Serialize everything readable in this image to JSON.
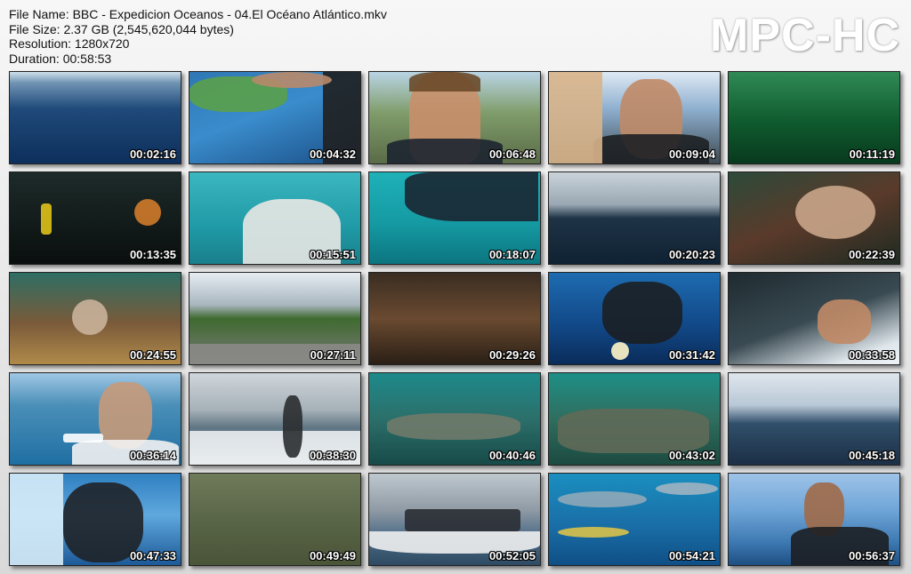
{
  "info": {
    "file_name": "File Name: BBC - Expedicion Oceanos - 04.El Océano Atlántico.mkv",
    "file_size": "File Size: 2.37 GB (2,545,620,044 bytes)",
    "resolution": "Resolution: 1280x720",
    "duration": "Duration: 00:58:53"
  },
  "logo": "MPC-HC",
  "thumbnails": [
    {
      "time": "00:02:16",
      "bg": "linear-gradient(180deg,#cfe0ea 0%,#6f93b3 12%,#1f4a7a 40%,#0d2f5c 100%)",
      "desc": "open-ocean"
    },
    {
      "time": "00:04:32",
      "bg": "linear-gradient(160deg,#2f77b5 0%,#3a8ccc 45%,#1a4f86 100%)",
      "desc": "map-hand"
    },
    {
      "time": "00:06:48",
      "bg": "linear-gradient(180deg,#b9d4e4 0%,#7f9c6a 45%,#5a6b48 100%)",
      "desc": "presenter-face"
    },
    {
      "time": "00:09:04",
      "bg": "linear-gradient(180deg,#dfe9f3 0%,#8fb0d0 40%,#3d4a52 100%)",
      "desc": "man-headphones"
    },
    {
      "time": "00:11:19",
      "bg": "linear-gradient(180deg,#2f8a55 0%,#0f5a2e 55%,#083a1e 100%)",
      "desc": "green-water"
    },
    {
      "time": "00:13:35",
      "bg": "linear-gradient(180deg,#1d2b2a 0%,#111a18 60%,#0a0f0e 100%)",
      "desc": "divers-dark"
    },
    {
      "time": "00:15:51",
      "bg": "linear-gradient(180deg,#3bb7c0 0%,#1f9aa6 60%,#1a7f8c 100%)",
      "desc": "boat-bow"
    },
    {
      "time": "00:18:07",
      "bg": "linear-gradient(180deg,#1fb1b8 0%,#159aa3 55%,#0c7580 100%)",
      "desc": "diver-rope"
    },
    {
      "time": "00:20:23",
      "bg": "linear-gradient(180deg,#c9d3da 0%,#9aa8b3 35%,#1e3346 50%,#0f2233 100%)",
      "desc": "boat-wake"
    },
    {
      "time": "00:22:39",
      "bg": "linear-gradient(160deg,#2d4a3a 0%,#5a3a2a 50%,#1e2a22 100%)",
      "desc": "lionfish"
    },
    {
      "time": "00:24:55",
      "bg": "linear-gradient(180deg,#2e6e63 0%,#7a5a3a 55%,#b08a4a 100%)",
      "desc": "reef-lionfish"
    },
    {
      "time": "00:27:11",
      "bg": "linear-gradient(180deg,#e6edf2 0%,#a8b6bf 35%,#3f6a2f 50%,#7a7a78 100%)",
      "desc": "road"
    },
    {
      "time": "00:29:26",
      "bg": "linear-gradient(180deg,#3a2d22 0%,#6a4a30 50%,#2a1f16 100%)",
      "desc": "cave"
    },
    {
      "time": "00:31:42",
      "bg": "linear-gradient(180deg,#1e6bb0 0%,#124a8a 55%,#0a2c5a 100%)",
      "desc": "diver-descending"
    },
    {
      "time": "00:33:58",
      "bg": "linear-gradient(160deg,#1e2b30 0%,#3a4a52 50%,#dfe7ec 85%,#eef3f6 100%)",
      "desc": "gear-hands"
    },
    {
      "time": "00:36:14",
      "bg": "linear-gradient(180deg,#9fc7e4 0%,#4a8fb8 35%,#1f6fa3 100%)",
      "desc": "woman-boat"
    },
    {
      "time": "00:38:30",
      "bg": "linear-gradient(180deg,#cfd6db 0%,#a7b1b8 40%,#5d7482 60%,#e8ecee 100%)",
      "desc": "man-deck"
    },
    {
      "time": "00:40:46",
      "bg": "linear-gradient(180deg,#1d8a8a 0%,#2c6f6a 50%,#174a48 100%)",
      "desc": "wreck-cannons"
    },
    {
      "time": "00:43:02",
      "bg": "linear-gradient(180deg,#1e8f86 0%,#2f6e5f 50%,#1c4a40 100%)",
      "desc": "wreck-debris"
    },
    {
      "time": "00:45:18",
      "bg": "linear-gradient(180deg,#dfe6ec 0%,#b8c8d6 35%,#314f6b 55%,#1b2f45 100%)",
      "desc": "sea-horizon"
    },
    {
      "time": "00:47:33",
      "bg": "linear-gradient(180deg,#2f7fc0 0%,#5fa8de 45%,#1d5a98 100%)",
      "desc": "diver-splash"
    },
    {
      "time": "00:49:49",
      "bg": "linear-gradient(180deg,#6f7a5a 0%,#5a6648 50%,#4a5438 100%)",
      "desc": "murky-water"
    },
    {
      "time": "00:52:05",
      "bg": "linear-gradient(180deg,#bfc8cf 0%,#8f9aa4 40%,#4a6a86 70%,#2f4a62 100%)",
      "desc": "dive-boat"
    },
    {
      "time": "00:54:21",
      "bg": "linear-gradient(180deg,#1a8fbf 0%,#1a6fa8 55%,#0f4f86 100%)",
      "desc": "sharks"
    },
    {
      "time": "00:56:37",
      "bg": "linear-gradient(180deg,#9ec3e8 0%,#6fa5d8 40%,#3d79b2 75%,#1f4f82 100%)",
      "desc": "woman-diver"
    }
  ]
}
